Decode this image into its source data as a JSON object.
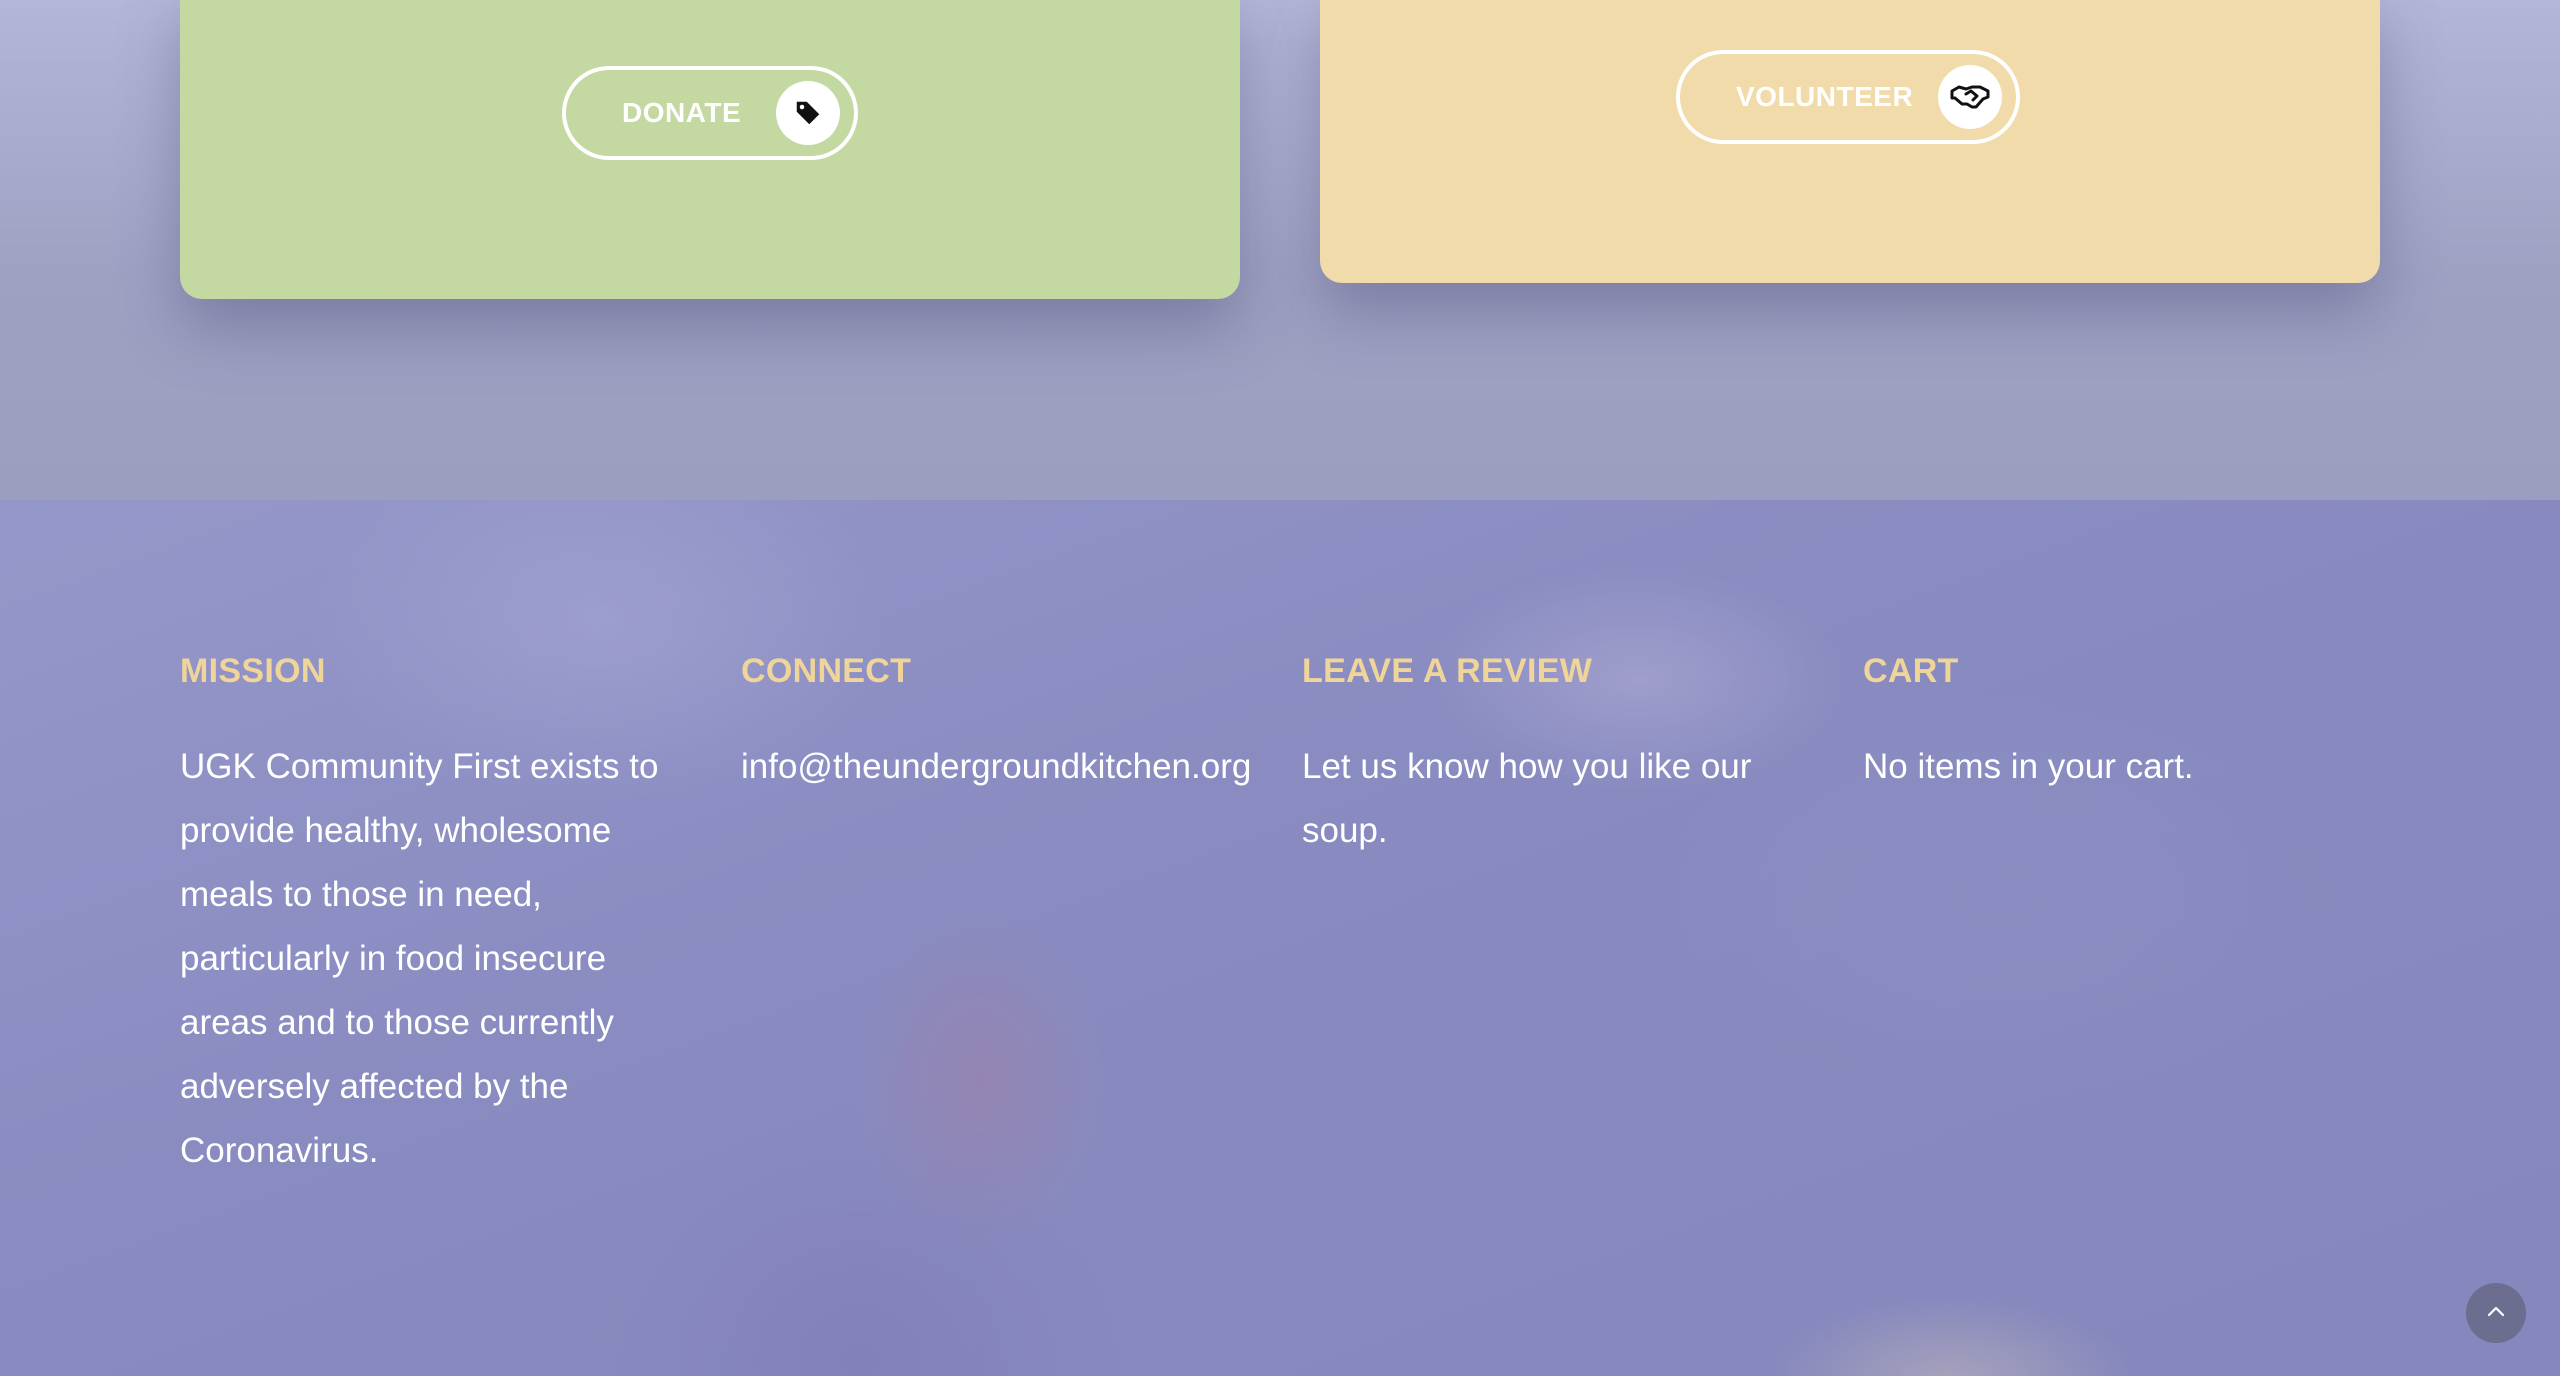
{
  "cards": {
    "donate": {
      "label": "DONATE",
      "icon": "tag-icon",
      "color": "#c4d8a2"
    },
    "volunteer": {
      "label": "VOLUNTEER",
      "icon": "handshake-icon",
      "color": "#f1dbaa"
    }
  },
  "footer": {
    "heading_color": "#f0d59a",
    "mission": {
      "heading": "MISSION",
      "text": "UGK Community First exists to provide healthy, wholesome meals to those in need, particularly in food insecure areas and to those currently adversely affected by the Coronavirus."
    },
    "connect": {
      "heading": "CONNECT",
      "email": "info@theundergroundkitchen.org"
    },
    "review": {
      "heading": "LEAVE A REVIEW",
      "text": "Let us know how you like our soup."
    },
    "cart": {
      "heading": "CART",
      "text": "No items in your cart."
    }
  },
  "back_to_top": {
    "icon": "chevron-up-icon"
  }
}
